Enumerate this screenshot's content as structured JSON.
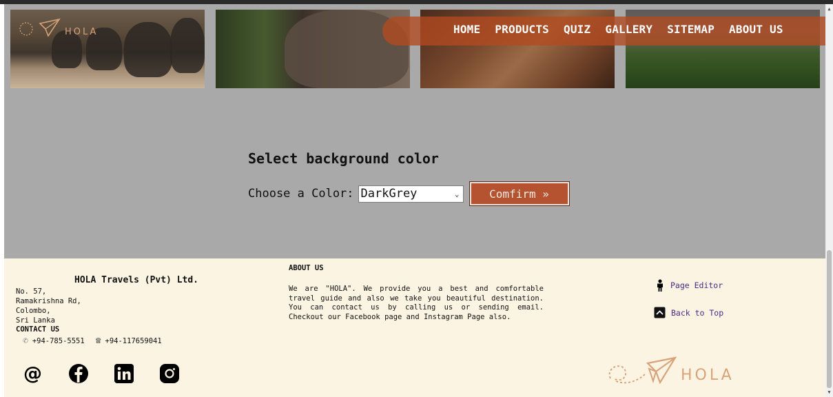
{
  "header": {
    "logo_text": "HOLA",
    "nav": [
      "HOME",
      "PRODUCTS",
      "QUIZ",
      "GALLERY",
      "SITEMAP",
      "ABOUT US"
    ]
  },
  "form": {
    "title": "Select background color",
    "label": "Choose a Color:",
    "selected": "DarkGrey",
    "confirm_label": "Comfirm »"
  },
  "footer": {
    "company": "HOLA Travels (Pvt) Ltd.",
    "address": [
      "No. 57,",
      "Ramakrishna Rd,",
      "Colombo,",
      "Sri Lanka"
    ],
    "contact_title": "CONTACT US",
    "phone_mobile": "+94-785-5551",
    "phone_land": "+94-117659041",
    "social": [
      "email-icon",
      "facebook-icon",
      "linkedin-icon",
      "instagram-icon"
    ],
    "about_title": "ABOUT US",
    "about_text": "We are \"HOLA\". We provide you a best and comfortable travel guide and also we take you beautiful destination. You can contact us by calling us or sending email. Checkout our Facebook page and Instagram Page also.",
    "page_editor": "Page Editor",
    "back_to_top": "Back to Top",
    "logo_text": "HOLA"
  },
  "colors": {
    "page_bg": "#a9a9a9",
    "footer_bg": "#fbf4e2",
    "nav_bg": "#b24a20",
    "button_bg": "#b5522f",
    "link": "#4b2a86",
    "logo_accent": "#d9a37a"
  }
}
